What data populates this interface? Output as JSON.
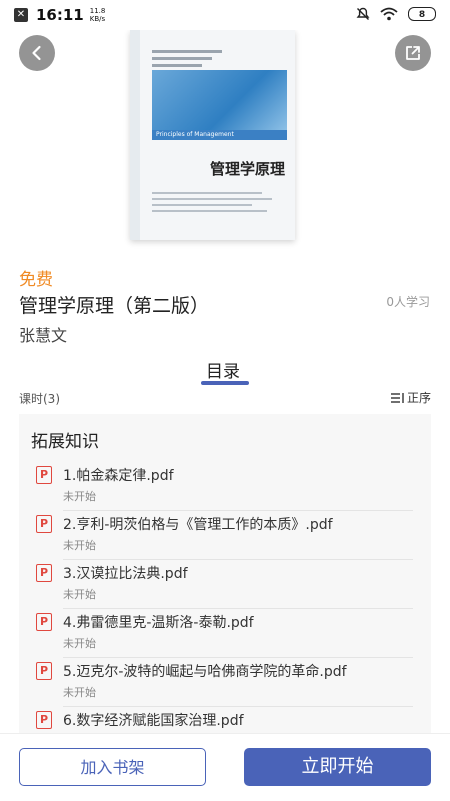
{
  "status_bar": {
    "time": "16:11",
    "speed_value": "11.8",
    "speed_unit": "KB/s",
    "battery": "8"
  },
  "cover": {
    "subtitle_en": "Principles of Management",
    "title": "管理学原理"
  },
  "course": {
    "price": "免费",
    "title": "管理学原理（第二版）",
    "learners": "0人学习",
    "author": "张慧文"
  },
  "tabs": {
    "toc_label": "目录"
  },
  "list_header": {
    "count": "课时(3)",
    "sort_label": "正序"
  },
  "section": {
    "title": "拓展知识",
    "items": [
      {
        "title": "1.帕金森定律.pdf",
        "status": "未开始"
      },
      {
        "title": "2.亨利-明茨伯格与《管理工作的本质》.pdf",
        "status": "未开始"
      },
      {
        "title": "3.汉谟拉比法典.pdf",
        "status": "未开始"
      },
      {
        "title": "4.弗雷德里克-温斯洛-泰勒.pdf",
        "status": "未开始"
      },
      {
        "title": "5.迈克尔-波特的崛起与哈佛商学院的革命.pdf",
        "status": "未开始"
      },
      {
        "title": "6.数字经济赋能国家治理.pdf",
        "status": ""
      }
    ]
  },
  "actions": {
    "add_to_shelf": "加入书架",
    "start_now": "立即开始"
  },
  "colors": {
    "accent": "#4a63b8",
    "price": "#f08a24",
    "pdf_icon": "#e0483f"
  }
}
